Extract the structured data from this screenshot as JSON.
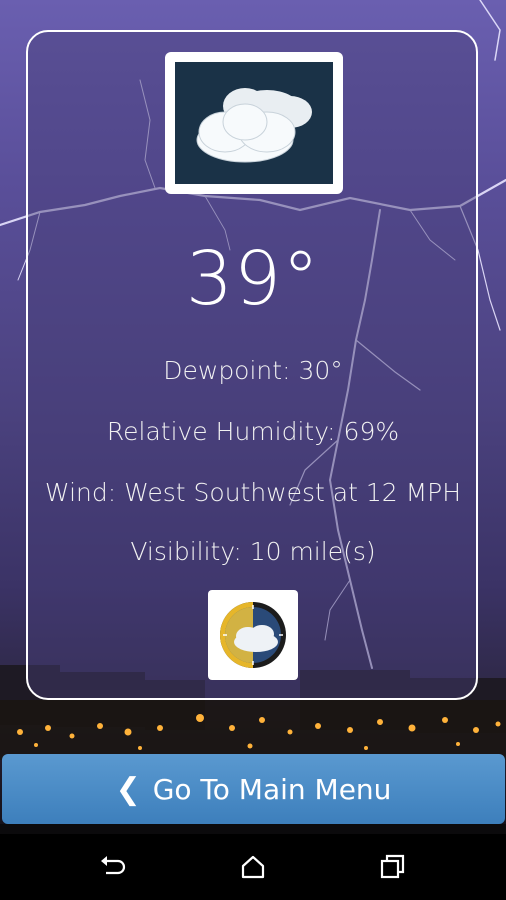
{
  "weather": {
    "temperature": "39°",
    "dewpoint": "Dewpoint: 30°",
    "humidity": "Relative Humidity: 69%",
    "wind": "Wind: West Southwest at 12 MPH",
    "visibility": "Visibility: 10 mile(s)",
    "condition_icon": "cloudy-icon"
  },
  "menu_button": {
    "label": "Go To Main Menu",
    "icon": "chevron-left-icon"
  },
  "navbar": {
    "back_icon": "back-icon",
    "home_icon": "home-icon",
    "recents_icon": "recents-icon"
  },
  "colors": {
    "button": "#3d7fbc",
    "text": "#ffffff",
    "card_border": "#ffffff"
  }
}
